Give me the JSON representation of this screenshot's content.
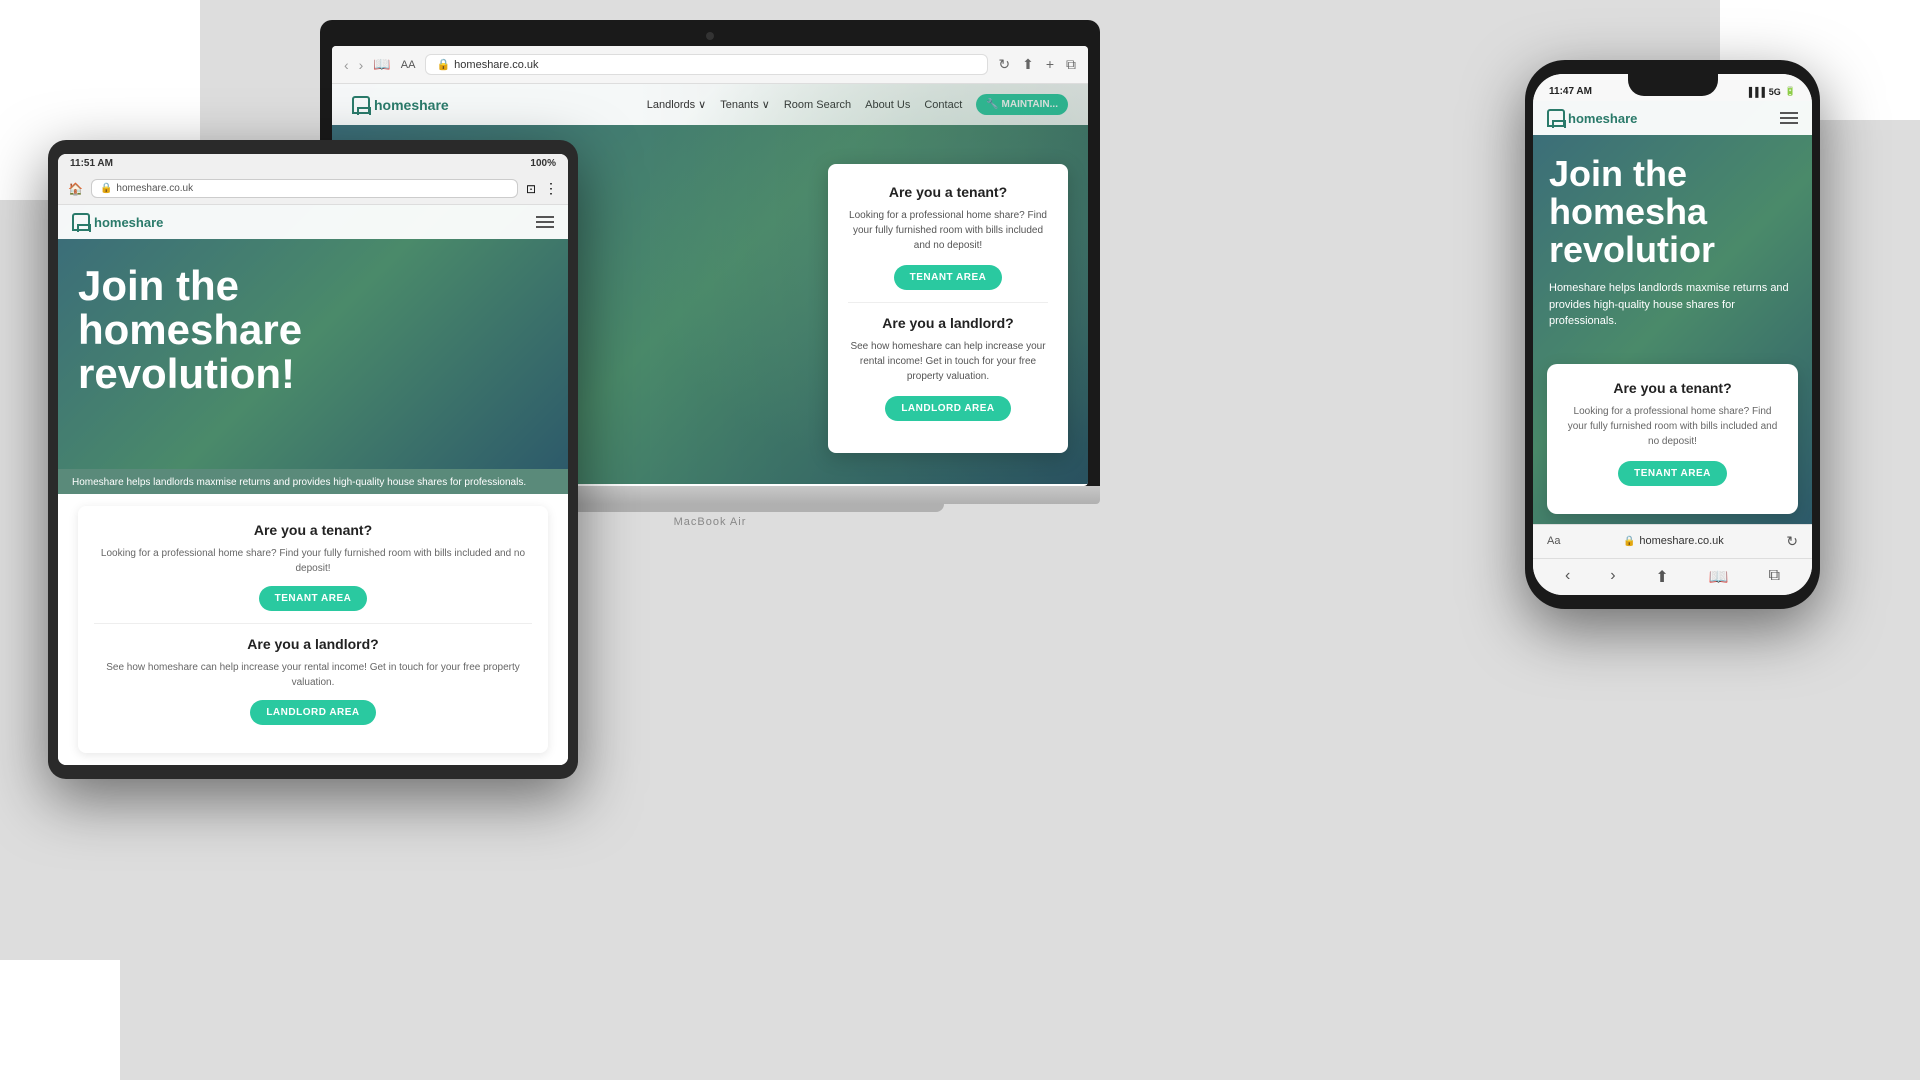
{
  "brand": {
    "name": "homeshare",
    "url": "homeshare.co.uk",
    "logo_text": "homeshare",
    "color_primary": "#2ac9a0",
    "color_dark": "#2a5a6a"
  },
  "nav": {
    "links": [
      "Landlords",
      "Tenants",
      "Room Search",
      "About Us",
      "Contact"
    ],
    "cta_label": "MAINTAIN..."
  },
  "hero": {
    "headline": "Join the homeshare revolution!",
    "subtext": "Homeshare helps landlords maxmise returns and provides high-quality house shares for professionals."
  },
  "cta_tenant": {
    "heading": "Are you a tenant?",
    "description": "Looking for a professional home share? Find your fully furnished room with bills included and no deposit!",
    "button_label": "TENANT AREA"
  },
  "cta_landlord": {
    "heading": "Are you a landlord?",
    "description": "See how homeshare can help increase your rental income! Get in touch for your free property valuation.",
    "button_label": "LANDLORD AREA"
  },
  "macbook": {
    "label": "MacBook Air",
    "url": "homeshare.co.uk",
    "aa_label": "AA"
  },
  "tablet": {
    "status_time": "11:51 AM",
    "status_battery": "100%",
    "url": "homeshare.co.uk"
  },
  "phone": {
    "status_time": "11:47 AM",
    "status_signal": "5G",
    "url": "homeshare.co.uk",
    "aa_label": "Aa"
  }
}
